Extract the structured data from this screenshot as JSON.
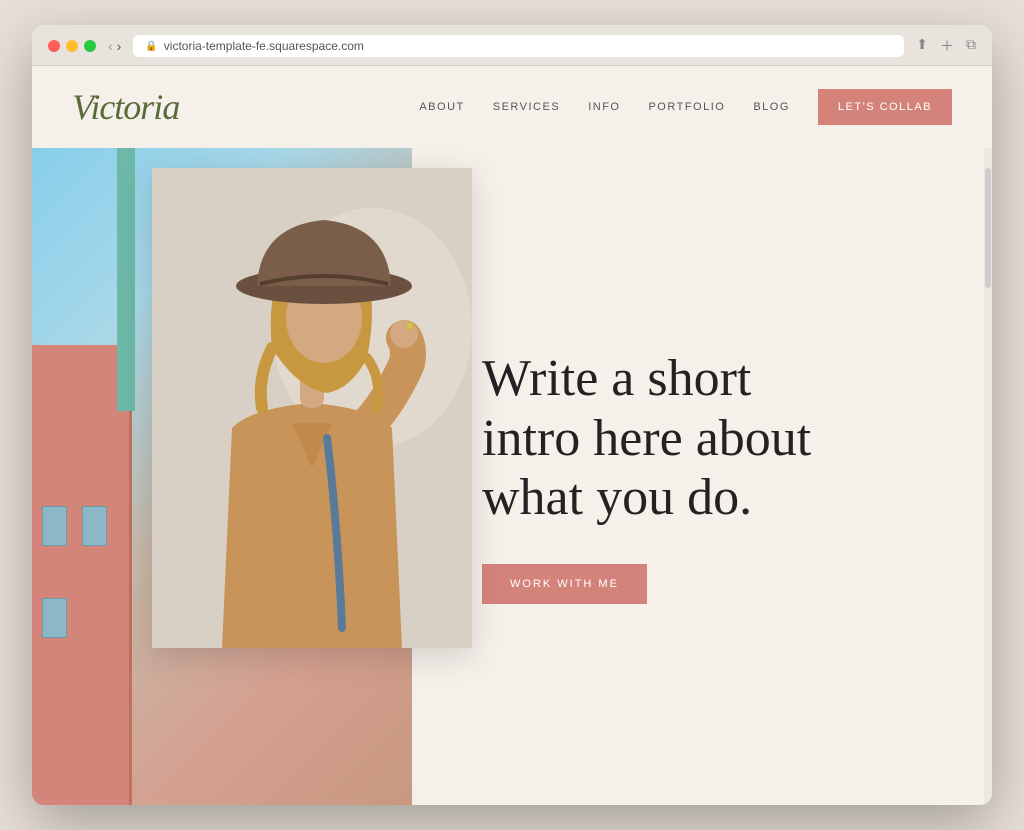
{
  "browser": {
    "url": "victoria-template-fe.squarespace.com",
    "reload_icon": "↺"
  },
  "nav": {
    "logo": "Victoria",
    "links": [
      {
        "label": "ABOUT",
        "key": "about"
      },
      {
        "label": "SERVICES",
        "key": "services"
      },
      {
        "label": "INFO",
        "key": "info"
      },
      {
        "label": "PORTFOLIO",
        "key": "portfolio"
      },
      {
        "label": "BLOG",
        "key": "blog"
      }
    ],
    "cta_label": "LET'S COLLAB"
  },
  "hero": {
    "headline": "Write a short intro here about what you do.",
    "cta_label": "WORK WITH ME"
  },
  "colors": {
    "accent": "#d4837a",
    "logo_green": "#5a6b3a",
    "bg_cream": "#f5f0ea"
  }
}
